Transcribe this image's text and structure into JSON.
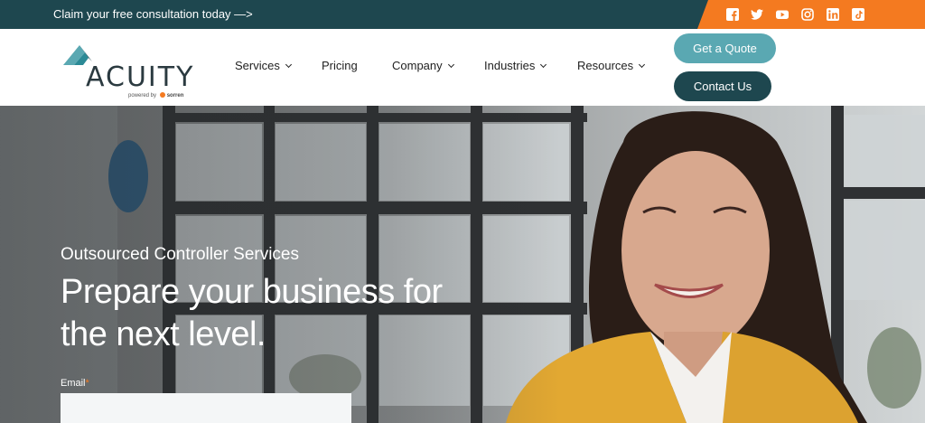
{
  "topbar": {
    "promo_text": "Claim your free consultation today —>",
    "social_icons": [
      "facebook-icon",
      "twitter-icon",
      "youtube-icon",
      "instagram-icon",
      "linkedin-icon",
      "tiktok-icon"
    ],
    "accent_color": "#f47a20",
    "bar_color": "#1e474f"
  },
  "header": {
    "logo": {
      "word": "ACUITY",
      "powered_prefix": "powered by",
      "powered_brand": "sorren"
    },
    "nav": [
      {
        "label": "Services",
        "has_dropdown": true
      },
      {
        "label": "Pricing",
        "has_dropdown": false
      },
      {
        "label": "Company",
        "has_dropdown": true
      },
      {
        "label": "Industries",
        "has_dropdown": true
      },
      {
        "label": "Resources",
        "has_dropdown": true
      }
    ],
    "quote_button": "Get a Quote",
    "contact_button": "Contact Us",
    "quote_color": "#5aa8b2",
    "contact_color": "#1e474f"
  },
  "hero": {
    "subtitle": "Outsourced Controller Services",
    "headline": "Prepare your business for the next level.",
    "email_label": "Email",
    "email_required_mark": "*",
    "email_value": ""
  }
}
